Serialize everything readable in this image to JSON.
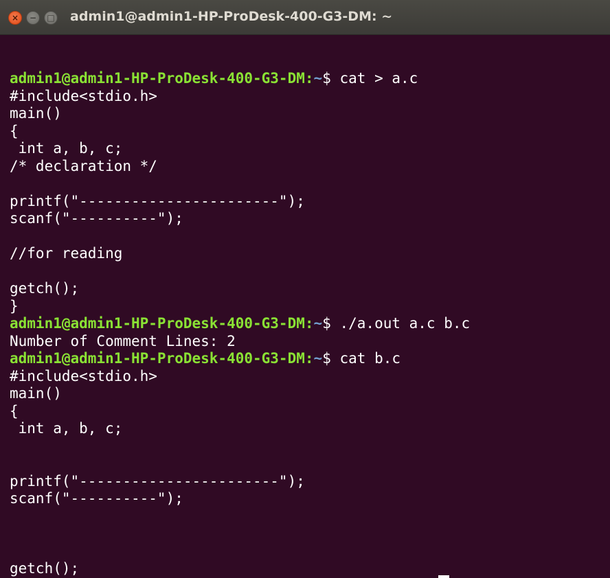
{
  "window": {
    "title": "admin1@admin1-HP-ProDesk-400-G3-DM: ~",
    "close_glyph": "×",
    "minimize_glyph": "−",
    "maximize_glyph": "□"
  },
  "colors": {
    "background": "#300a24",
    "prompt_user": "#8ae234",
    "prompt_path": "#729fcf",
    "text": "#ffffff",
    "close_button": "#df4a16"
  },
  "prompt": {
    "user_host": "admin1@admin1-HP-ProDesk-400-G3-DM",
    "path": "~",
    "symbol": "$"
  },
  "terminal": {
    "lines": [
      {
        "type": "prompt",
        "command": "cat > a.c"
      },
      {
        "type": "output",
        "text": "#include<stdio.h>"
      },
      {
        "type": "output",
        "text": "main()"
      },
      {
        "type": "output",
        "text": "{"
      },
      {
        "type": "output",
        "text": " int a, b, c;"
      },
      {
        "type": "output",
        "text": "/* declaration */"
      },
      {
        "type": "output",
        "text": ""
      },
      {
        "type": "output",
        "text": "printf(\"-----------------------\");"
      },
      {
        "type": "output",
        "text": "scanf(\"----------\");"
      },
      {
        "type": "output",
        "text": ""
      },
      {
        "type": "output",
        "text": "//for reading"
      },
      {
        "type": "output",
        "text": ""
      },
      {
        "type": "output",
        "text": "getch();"
      },
      {
        "type": "output",
        "text": "}"
      },
      {
        "type": "prompt",
        "command": "./a.out a.c b.c"
      },
      {
        "type": "output",
        "text": "Number of Comment Lines: 2"
      },
      {
        "type": "prompt",
        "command": "cat b.c"
      },
      {
        "type": "output",
        "text": "#include<stdio.h>"
      },
      {
        "type": "output",
        "text": "main()"
      },
      {
        "type": "output",
        "text": "{"
      },
      {
        "type": "output",
        "text": " int a, b, c;"
      },
      {
        "type": "output",
        "text": ""
      },
      {
        "type": "output",
        "text": ""
      },
      {
        "type": "output",
        "text": "printf(\"-----------------------\");"
      },
      {
        "type": "output",
        "text": "scanf(\"----------\");"
      },
      {
        "type": "output",
        "text": ""
      },
      {
        "type": "output",
        "text": ""
      },
      {
        "type": "output",
        "text": ""
      },
      {
        "type": "output",
        "text": "getch();"
      },
      {
        "type": "output",
        "text": "}"
      }
    ]
  }
}
